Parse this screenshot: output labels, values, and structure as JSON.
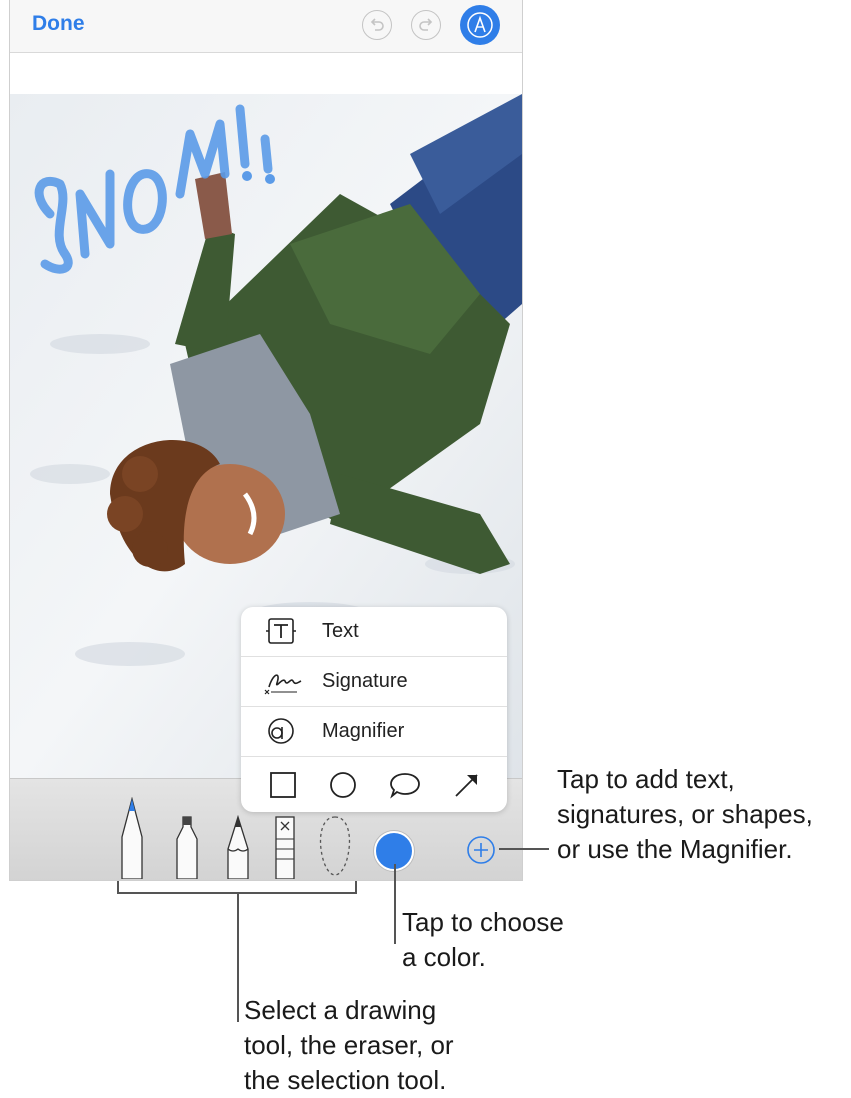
{
  "topbar": {
    "done_label": "Done",
    "undo_icon": "undo-icon",
    "redo_icon": "redo-icon",
    "markup_icon": "markup-pen-icon",
    "accent": "#2f7ee8"
  },
  "photo": {
    "scribble_text": "SNOW!!"
  },
  "popover": {
    "items": [
      {
        "icon": "text-icon",
        "label": "Text"
      },
      {
        "icon": "signature-icon",
        "label": "Signature"
      },
      {
        "icon": "magnifier-icon",
        "label": "Magnifier"
      }
    ],
    "shapes": [
      "square-icon",
      "circle-icon",
      "speech-bubble-icon",
      "arrow-icon"
    ]
  },
  "toolbar": {
    "tools": [
      "pen-icon",
      "marker-icon",
      "pencil-icon",
      "eraser-icon",
      "lasso-icon"
    ],
    "color_icon": "color-picker-icon",
    "add_icon": "add-icon",
    "selected_color": "#2f7ee8"
  },
  "callouts": {
    "add": [
      "Tap to add text,",
      "signatures, or shapes,",
      "or use the Magnifier."
    ],
    "color": [
      "Tap to choose",
      "a color."
    ],
    "tools": [
      "Select a drawing",
      "tool, the eraser, or",
      "the selection tool."
    ]
  }
}
